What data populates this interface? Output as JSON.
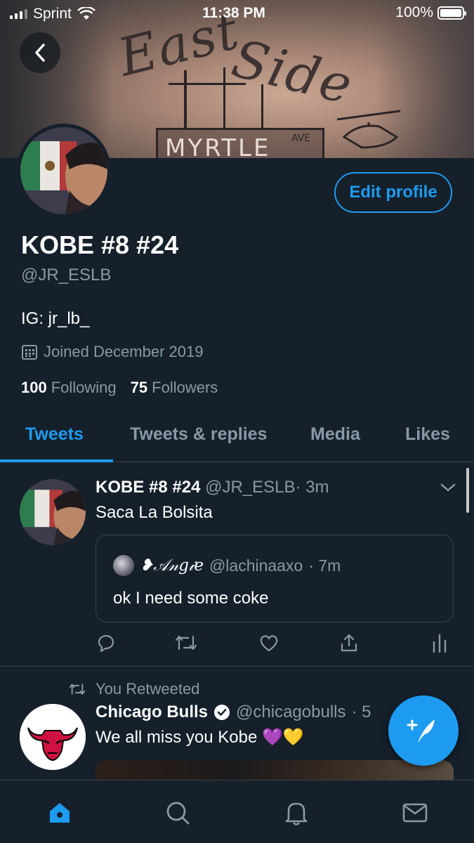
{
  "status_bar": {
    "carrier": "Sprint",
    "time": "11:38 PM",
    "battery": "100%"
  },
  "header": {
    "banner_text_1": "East",
    "banner_text_2": "Side",
    "banner_sign": "MYRTLE",
    "banner_sign_small": "AVE"
  },
  "profile": {
    "edit_label": "Edit profile",
    "name": "KOBE #8 #24",
    "handle": "@JR_ESLB",
    "bio": "IG: jr_lb_",
    "joined": "Joined December 2019",
    "following_count": "100",
    "following_label": "Following",
    "followers_count": "75",
    "followers_label": "Followers"
  },
  "tabs": [
    {
      "label": "Tweets",
      "active": true
    },
    {
      "label": "Tweets & replies",
      "active": false
    },
    {
      "label": "Media",
      "active": false
    },
    {
      "label": "Likes",
      "active": false
    }
  ],
  "tweets": [
    {
      "name": "KOBE #8 #24",
      "handle": "@JR_ESLB",
      "time": "· 3m",
      "text": "Saca La Bolsita",
      "quote": {
        "name": "❥𝒜𝓃𝑔𝒾𝑒",
        "handle": "@lachinaaxo",
        "time": "· 7m",
        "text": "ok I need some coke"
      }
    },
    {
      "retweet_label": "You Retweeted",
      "name": "Chicago Bulls",
      "handle": "@chicagobulls",
      "time": "· 5",
      "text": "We all miss you Kobe 💜💛"
    }
  ],
  "colors": {
    "background": "#15202b",
    "accent": "#1d9bf0",
    "muted": "#8899a6",
    "border": "#38444d"
  },
  "icons": {
    "back": "chevron-left-icon",
    "calendar": "calendar-icon",
    "reply": "reply-icon",
    "retweet": "retweet-icon",
    "like": "heart-icon",
    "share": "share-icon",
    "analytics": "analytics-icon",
    "compose": "compose-tweet-icon",
    "home": "home-icon",
    "search": "search-icon",
    "notifications": "bell-icon",
    "messages": "mail-icon"
  }
}
